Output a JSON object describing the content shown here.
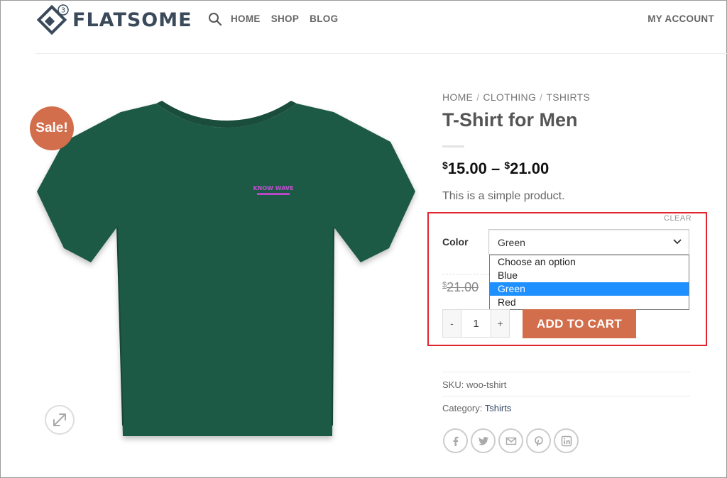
{
  "header": {
    "logo_text": "FLATSOME",
    "logo_badge": "3",
    "nav": [
      "HOME",
      "SHOP",
      "BLOG"
    ],
    "account": "MY ACCOUNT"
  },
  "product": {
    "sale_badge": "Sale!",
    "image_print_line1": "KNOW WAVE",
    "breadcrumb": [
      "HOME",
      "CLOTHING",
      "TSHIRTS"
    ],
    "breadcrumb_sep": "/",
    "title": "T-Shirt for Men",
    "price_currency": "$",
    "price_low": "15.00",
    "price_dash": "–",
    "price_high": "21.00",
    "description": "This is a simple product.",
    "variation": {
      "clear_label": "CLEAR",
      "label": "Color",
      "selected": "Green",
      "options": [
        "Choose an option",
        "Blue",
        "Green",
        "Red"
      ]
    },
    "old_price": "21.00",
    "quantity": "1",
    "qty_minus": "-",
    "qty_plus": "+",
    "add_to_cart": "ADD TO CART",
    "sku_label": "SKU: woo-tshirt",
    "category_label": "Category: ",
    "category_link": "Tshirts",
    "share_icons": [
      "facebook-icon",
      "twitter-icon",
      "email-icon",
      "pinterest-icon",
      "linkedin-icon"
    ]
  },
  "colors": {
    "accent": "#d26e4b",
    "highlight": "#e0262e",
    "shirt": "#1f5a45",
    "dropdown_selected": "#1e90ff"
  }
}
